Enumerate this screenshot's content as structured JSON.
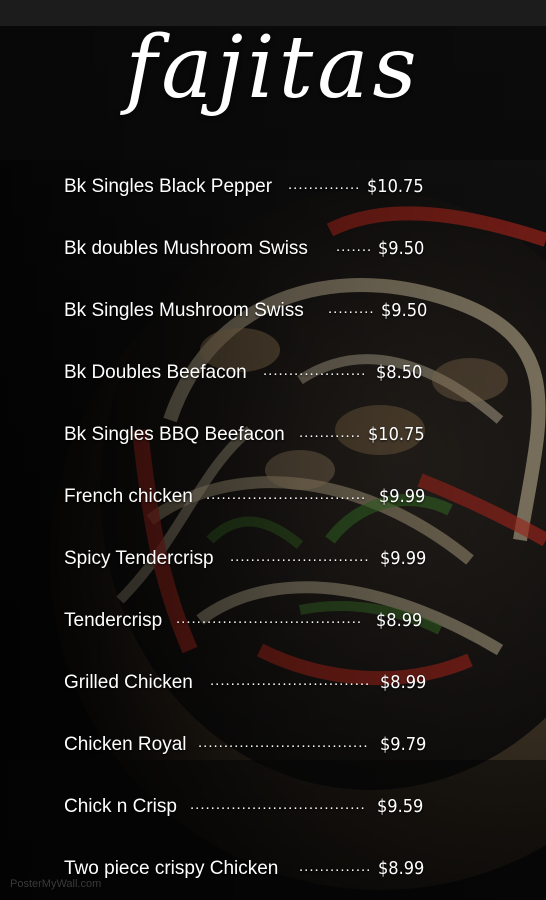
{
  "title": "fajitas",
  "menu": {
    "items": [
      {
        "name": "Bk Singles Black Pepper",
        "dots": "..............",
        "price": "$10.75"
      },
      {
        "name": "Bk doubles Mushroom Swiss",
        "dots": ".......",
        "price": "$9.50"
      },
      {
        "name": "Bk Singles Mushroom Swiss",
        "dots": ".........",
        "price": "$9.50"
      },
      {
        "name": "Bk Doubles Beefacon",
        "dots": "....................",
        "price": "$8.50"
      },
      {
        "name": "Bk Singles BBQ Beefacon",
        "dots": "............",
        "price": "$10.75"
      },
      {
        "name": "French chicken",
        "dots": "...............................",
        "price": "$9.99"
      },
      {
        "name": "Spicy Tendercrisp",
        "dots": "...........................",
        "price": "$9.99"
      },
      {
        "name": "Tendercrisp",
        "dots": "....................................",
        "price": "$8.99"
      },
      {
        "name": "Grilled Chicken",
        "dots": "...............................",
        "price": "$8.99"
      },
      {
        "name": "Chicken Royal",
        "dots": ".................................",
        "price": "$9.79"
      },
      {
        "name": "Chick n Crisp",
        "dots": "..................................",
        "price": "$9.59"
      },
      {
        "name": "Two piece crispy Chicken",
        "dots": "..............",
        "price": "$8.99"
      }
    ]
  },
  "watermark": "PosterMyWall.com"
}
